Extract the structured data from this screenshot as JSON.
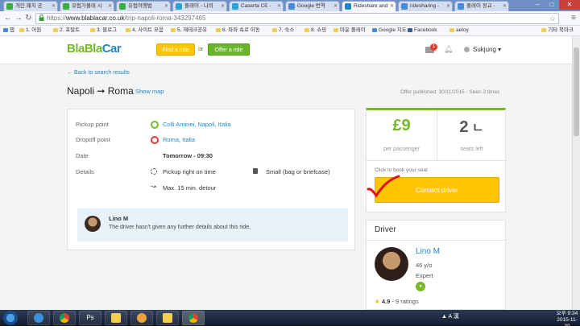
{
  "browser": {
    "tabs": [
      {
        "label": "개인 패치 공"
      },
      {
        "label": "유럽가볼래 시"
      },
      {
        "label": "유럽여행법"
      },
      {
        "label": "플레이 - 나의"
      },
      {
        "label": "Caserta CE -"
      },
      {
        "label": "Google 번역"
      },
      {
        "label": "Rideshare and"
      },
      {
        "label": "ridesharing -"
      },
      {
        "label": "플레이 정교 - "
      }
    ],
    "url_prefix": "https://",
    "url_host": "www.blablacar.co.uk",
    "url_path": "/trip-napoli-roma-343297465",
    "window_buttons": {
      "minimize": "–",
      "maximize": "□",
      "close": "✕"
    },
    "bookmarks": [
      "앱",
      "1. 어원",
      "2. 포탈트",
      "3. 블로그",
      "4. 사이트 모음",
      "5. 재테크공유",
      "6. 파파 속로 이동",
      "7. 숙소",
      "8. 쇼핑",
      "마운 플레이",
      "Google 지도",
      "Facebook",
      "aetoy"
    ],
    "bookmarks_other": "기타 북마크"
  },
  "header": {
    "logo_bla1": "Bla",
    "logo_bla2": "Bla",
    "logo_car": "Car",
    "find_ride": "Find a ride",
    "or": "or",
    "offer_ride": "Offer a ride",
    "message_count": "1",
    "username": "Sukjung"
  },
  "trip": {
    "back_link": "← Back to search results",
    "title": "Napoli ➞ Roma",
    "show_map": "Show map",
    "offer_published": "Offer published: 30/11/2015 - Seen 3 times",
    "pickup_label": "Pickup point",
    "pickup_value": "Colli Aminei, Napoli, Italia",
    "dropoff_label": "Dropoff point",
    "dropoff_value": "Roma, Italia",
    "date_label": "Date",
    "date_value": "Tomorrow - 09:30",
    "details_label": "Details",
    "detail_time": "Pickup right on time",
    "detail_luggage": "Small (bag or briefcase)",
    "detail_detour": "Max. 15 min. detour",
    "note_driver": "Lino M",
    "note_text": "The driver hasn't given any further details about this ride."
  },
  "booking": {
    "price": "£9",
    "price_label": "per passenger",
    "seats": "2",
    "seats_label": "seats left",
    "click_hint": "Click to book your seat",
    "contact_button": "Contact driver"
  },
  "driver": {
    "heading": "Driver",
    "name": "Lino M",
    "age": "46 y/o",
    "experience": "Expert",
    "rating": "4.9",
    "ratings_count": "- 9 ratings"
  },
  "taskbar": {
    "tray_text": "▲ A 漢",
    "time": "오후 9:34",
    "date": "2015-11-30"
  }
}
